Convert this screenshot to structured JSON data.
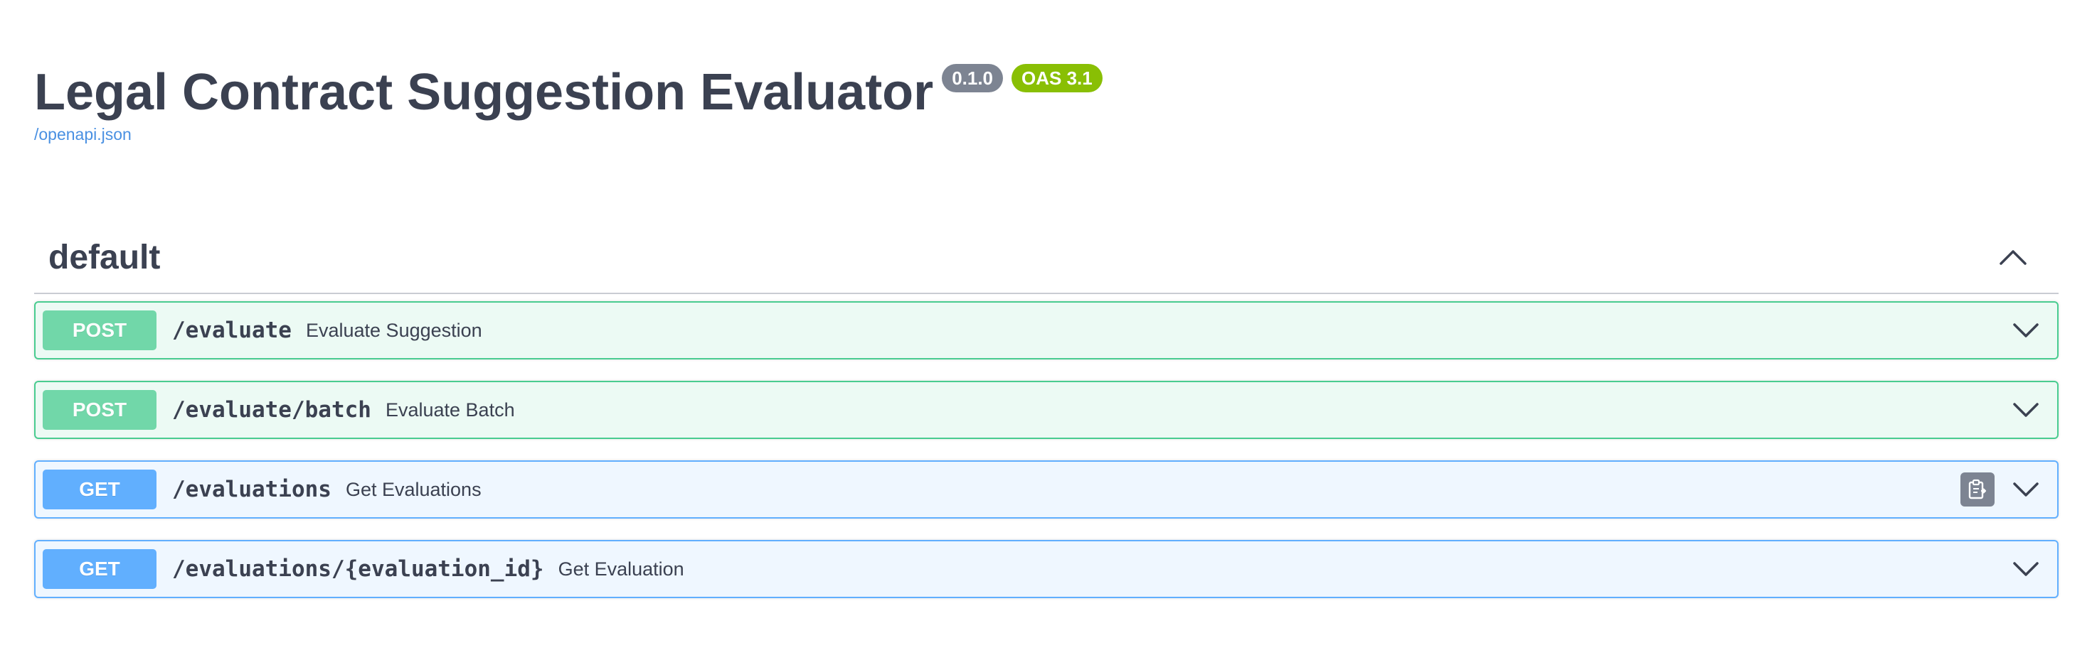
{
  "info": {
    "title": "Legal Contract Suggestion Evaluator",
    "version": "0.1.0",
    "oas_version": "OAS 3.1",
    "spec_link": "/openapi.json"
  },
  "tag": {
    "name": "default",
    "toggle_icon": "chevron-up-icon"
  },
  "operations": [
    {
      "method": "POST",
      "path": "/evaluate",
      "summary": "Evaluate Suggestion"
    },
    {
      "method": "POST",
      "path": "/evaluate/batch",
      "summary": "Evaluate Batch"
    },
    {
      "method": "GET",
      "path": "/evaluations",
      "summary": "Get Evaluations",
      "copy_icon": "clipboard-copy-icon"
    },
    {
      "method": "GET",
      "path": "/evaluations/{evaluation_id}",
      "summary": "Get Evaluation"
    }
  ],
  "colors": {
    "post": "#49cc90",
    "get": "#61affe",
    "link": "#4990e2",
    "version_badge": "#7d8492",
    "oas_badge": "#89bf04",
    "text": "#3b4151"
  }
}
